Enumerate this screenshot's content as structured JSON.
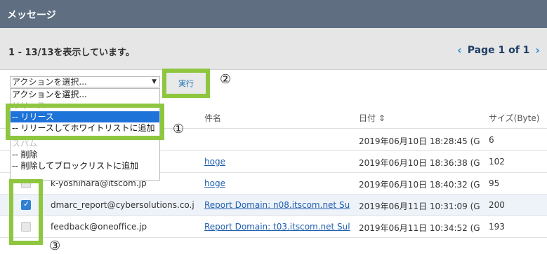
{
  "title": "メッセージ",
  "summary": "1 - 13/13を表示しています。",
  "pager": {
    "prev": "‹",
    "label": "Page 1 of 1",
    "next": "›"
  },
  "action_select": {
    "value": "アクションを選択...",
    "arrow": "▼",
    "options": [
      {
        "label": "アクションを選択...",
        "kind": "normal"
      },
      {
        "label": "リリース",
        "kind": "group"
      },
      {
        "label": "-- リリース",
        "kind": "selected"
      },
      {
        "label": "-- リリースしてホワイトリストに追加",
        "kind": "normal"
      },
      {
        "label": "スパム",
        "kind": "group"
      },
      {
        "label": "-- 削除",
        "kind": "normal"
      },
      {
        "label": "-- 削除してブロックリストに追加",
        "kind": "normal"
      }
    ]
  },
  "run_button": "実行",
  "markers": {
    "one": "①",
    "two": "②",
    "three": "③"
  },
  "columns": {
    "subject": "件名",
    "date": "日付 ⇕",
    "size": "サイズ(Byte)"
  },
  "rows": [
    {
      "sender": "",
      "subject": "",
      "date": "2019年06月10日 18:28:45 (G",
      "size": "6",
      "checked": false
    },
    {
      "sender": "",
      "subject": "hoge",
      "date": "2019年06月10日 18:36:38 (G",
      "size": "102",
      "checked": false
    },
    {
      "sender": "k-yoshihara@itscom.jp",
      "subject": "hoge",
      "date": "2019年06月10日 18:40:32 (G",
      "size": "95",
      "checked": false
    },
    {
      "sender": "dmarc_report@cybersolutions.co.j",
      "subject": "Report Domain: n08.itscom.net Su",
      "date": "2019年06月11日 10:31:09 (G",
      "size": "200",
      "checked": true
    },
    {
      "sender": "feedback@oneoffice.jp",
      "subject": "Report Domain: t03.itscom.net Sul",
      "date": "2019年06月11日 10:34:52 (G",
      "size": "193",
      "checked": false
    }
  ]
}
